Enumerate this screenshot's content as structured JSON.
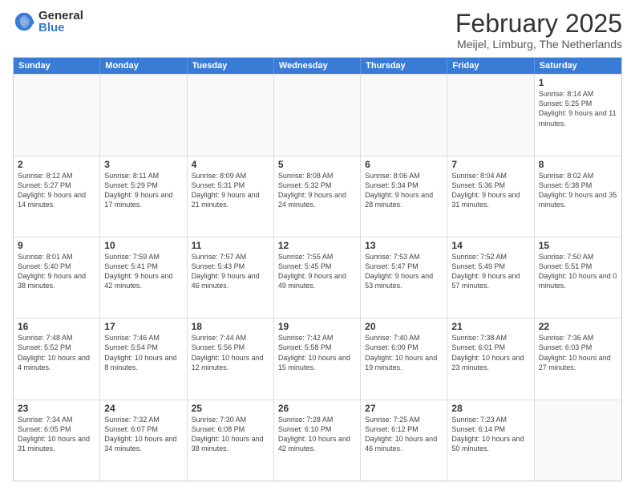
{
  "logo": {
    "general": "General",
    "blue": "Blue"
  },
  "title": "February 2025",
  "subtitle": "Meijel, Limburg, The Netherlands",
  "days": [
    "Sunday",
    "Monday",
    "Tuesday",
    "Wednesday",
    "Thursday",
    "Friday",
    "Saturday"
  ],
  "weeks": [
    [
      {
        "day": "",
        "info": ""
      },
      {
        "day": "",
        "info": ""
      },
      {
        "day": "",
        "info": ""
      },
      {
        "day": "",
        "info": ""
      },
      {
        "day": "",
        "info": ""
      },
      {
        "day": "",
        "info": ""
      },
      {
        "day": "1",
        "info": "Sunrise: 8:14 AM\nSunset: 5:25 PM\nDaylight: 9 hours and 11 minutes."
      }
    ],
    [
      {
        "day": "2",
        "info": "Sunrise: 8:12 AM\nSunset: 5:27 PM\nDaylight: 9 hours and 14 minutes."
      },
      {
        "day": "3",
        "info": "Sunrise: 8:11 AM\nSunset: 5:29 PM\nDaylight: 9 hours and 17 minutes."
      },
      {
        "day": "4",
        "info": "Sunrise: 8:09 AM\nSunset: 5:31 PM\nDaylight: 9 hours and 21 minutes."
      },
      {
        "day": "5",
        "info": "Sunrise: 8:08 AM\nSunset: 5:32 PM\nDaylight: 9 hours and 24 minutes."
      },
      {
        "day": "6",
        "info": "Sunrise: 8:06 AM\nSunset: 5:34 PM\nDaylight: 9 hours and 28 minutes."
      },
      {
        "day": "7",
        "info": "Sunrise: 8:04 AM\nSunset: 5:36 PM\nDaylight: 9 hours and 31 minutes."
      },
      {
        "day": "8",
        "info": "Sunrise: 8:02 AM\nSunset: 5:38 PM\nDaylight: 9 hours and 35 minutes."
      }
    ],
    [
      {
        "day": "9",
        "info": "Sunrise: 8:01 AM\nSunset: 5:40 PM\nDaylight: 9 hours and 38 minutes."
      },
      {
        "day": "10",
        "info": "Sunrise: 7:59 AM\nSunset: 5:41 PM\nDaylight: 9 hours and 42 minutes."
      },
      {
        "day": "11",
        "info": "Sunrise: 7:57 AM\nSunset: 5:43 PM\nDaylight: 9 hours and 46 minutes."
      },
      {
        "day": "12",
        "info": "Sunrise: 7:55 AM\nSunset: 5:45 PM\nDaylight: 9 hours and 49 minutes."
      },
      {
        "day": "13",
        "info": "Sunrise: 7:53 AM\nSunset: 5:47 PM\nDaylight: 9 hours and 53 minutes."
      },
      {
        "day": "14",
        "info": "Sunrise: 7:52 AM\nSunset: 5:49 PM\nDaylight: 9 hours and 57 minutes."
      },
      {
        "day": "15",
        "info": "Sunrise: 7:50 AM\nSunset: 5:51 PM\nDaylight: 10 hours and 0 minutes."
      }
    ],
    [
      {
        "day": "16",
        "info": "Sunrise: 7:48 AM\nSunset: 5:52 PM\nDaylight: 10 hours and 4 minutes."
      },
      {
        "day": "17",
        "info": "Sunrise: 7:46 AM\nSunset: 5:54 PM\nDaylight: 10 hours and 8 minutes."
      },
      {
        "day": "18",
        "info": "Sunrise: 7:44 AM\nSunset: 5:56 PM\nDaylight: 10 hours and 12 minutes."
      },
      {
        "day": "19",
        "info": "Sunrise: 7:42 AM\nSunset: 5:58 PM\nDaylight: 10 hours and 15 minutes."
      },
      {
        "day": "20",
        "info": "Sunrise: 7:40 AM\nSunset: 6:00 PM\nDaylight: 10 hours and 19 minutes."
      },
      {
        "day": "21",
        "info": "Sunrise: 7:38 AM\nSunset: 6:01 PM\nDaylight: 10 hours and 23 minutes."
      },
      {
        "day": "22",
        "info": "Sunrise: 7:36 AM\nSunset: 6:03 PM\nDaylight: 10 hours and 27 minutes."
      }
    ],
    [
      {
        "day": "23",
        "info": "Sunrise: 7:34 AM\nSunset: 6:05 PM\nDaylight: 10 hours and 31 minutes."
      },
      {
        "day": "24",
        "info": "Sunrise: 7:32 AM\nSunset: 6:07 PM\nDaylight: 10 hours and 34 minutes."
      },
      {
        "day": "25",
        "info": "Sunrise: 7:30 AM\nSunset: 6:08 PM\nDaylight: 10 hours and 38 minutes."
      },
      {
        "day": "26",
        "info": "Sunrise: 7:28 AM\nSunset: 6:10 PM\nDaylight: 10 hours and 42 minutes."
      },
      {
        "day": "27",
        "info": "Sunrise: 7:25 AM\nSunset: 6:12 PM\nDaylight: 10 hours and 46 minutes."
      },
      {
        "day": "28",
        "info": "Sunrise: 7:23 AM\nSunset: 6:14 PM\nDaylight: 10 hours and 50 minutes."
      },
      {
        "day": "",
        "info": ""
      }
    ]
  ]
}
